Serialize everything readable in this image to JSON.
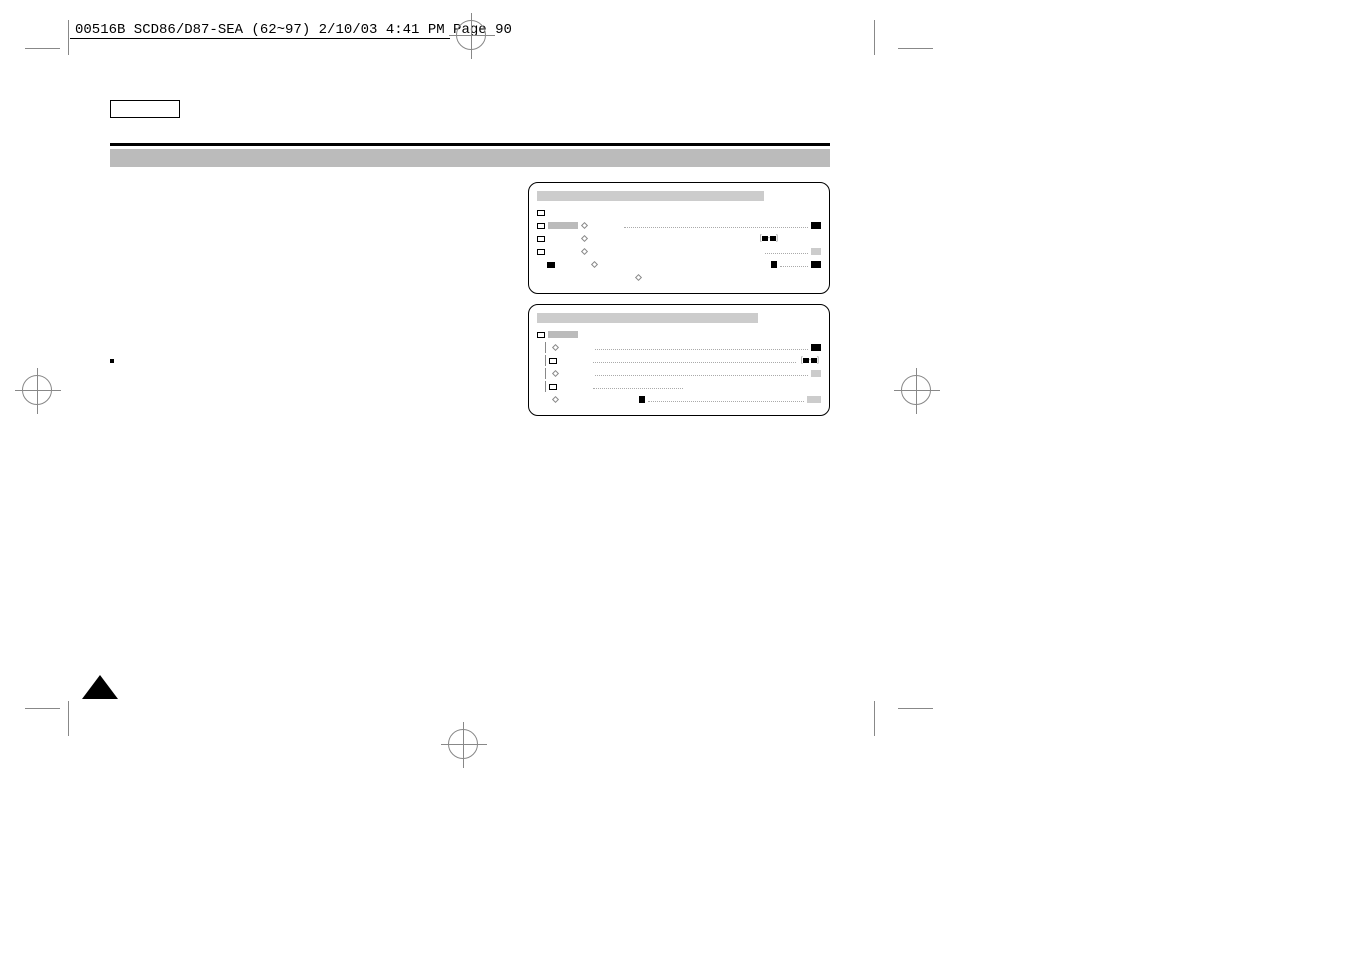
{
  "header": {
    "slug": "00516B SCD86/D87-SEA (62~97)  2/10/03 4:41 PM  Page 90"
  },
  "page_number": "",
  "diagram1": {
    "rows": [
      {
        "type": "folder"
      },
      {
        "type": "folder-highlight"
      },
      {
        "type": "folder"
      },
      {
        "type": "folder"
      },
      {
        "type": "dark"
      }
    ]
  },
  "diagram2": {
    "rows": [
      {
        "type": "folder"
      },
      {
        "type": "indent-diamond"
      },
      {
        "type": "indent-folder"
      },
      {
        "type": "indent-diamond-arrow"
      },
      {
        "type": "indent-folder"
      },
      {
        "type": "indent-diamond-arrow"
      }
    ]
  }
}
